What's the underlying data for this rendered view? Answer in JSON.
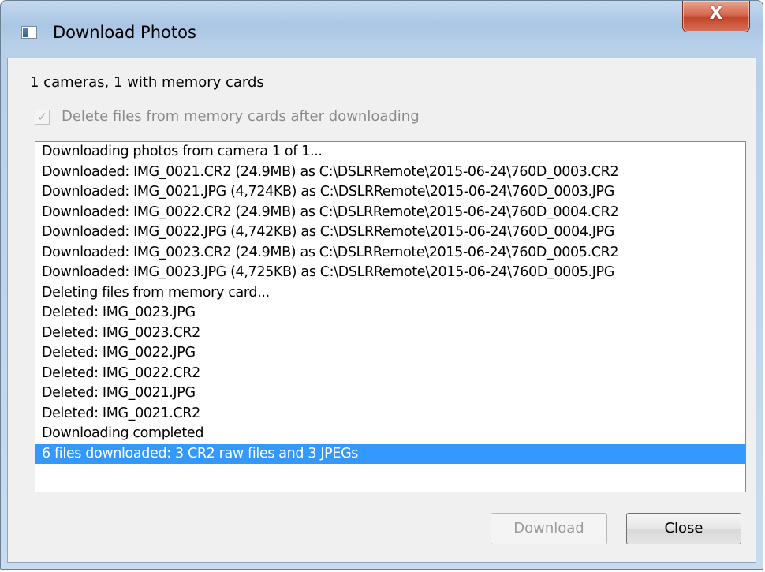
{
  "window": {
    "title": "Download Photos",
    "close_glyph": "X"
  },
  "status": {
    "camera_summary": "1 cameras, 1 with memory cards"
  },
  "options": {
    "delete_after_download": {
      "label": "Delete files from memory cards after downloading",
      "checked": true,
      "enabled": false,
      "check_glyph": "✓"
    }
  },
  "log": {
    "lines": [
      "Downloading photos from camera 1 of 1...",
      "Downloaded: IMG_0021.CR2 (24.9MB) as C:\\DSLRRemote\\2015-06-24\\760D_0003.CR2",
      "Downloaded: IMG_0021.JPG (4,724KB) as C:\\DSLRRemote\\2015-06-24\\760D_0003.JPG",
      "Downloaded: IMG_0022.CR2 (24.9MB) as C:\\DSLRRemote\\2015-06-24\\760D_0004.CR2",
      "Downloaded: IMG_0022.JPG (4,742KB) as C:\\DSLRRemote\\2015-06-24\\760D_0004.JPG",
      "Downloaded: IMG_0023.CR2 (24.9MB) as C:\\DSLRRemote\\2015-06-24\\760D_0005.CR2",
      "Downloaded: IMG_0023.JPG (4,725KB) as C:\\DSLRRemote\\2015-06-24\\760D_0005.JPG",
      "Deleting files from memory card...",
      "Deleted: IMG_0023.JPG",
      "Deleted: IMG_0023.CR2",
      "Deleted: IMG_0022.JPG",
      "Deleted: IMG_0022.CR2",
      "Deleted: IMG_0021.JPG",
      "Deleted: IMG_0021.CR2",
      "Downloading completed",
      "6 files downloaded: 3 CR2 raw files and 3 JPEGs"
    ],
    "selected_index": 15
  },
  "buttons": {
    "download": {
      "label": "Download",
      "enabled": false
    },
    "close": {
      "label": "Close",
      "enabled": true
    }
  },
  "colors": {
    "selection": "#3399ff",
    "disabled_text": "#9c9c9c"
  }
}
